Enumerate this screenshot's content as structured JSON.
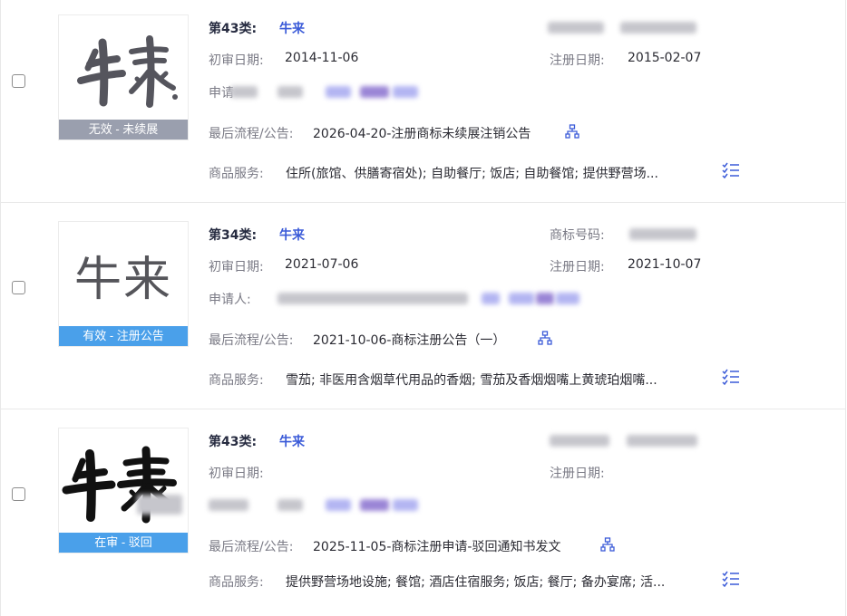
{
  "labels": {
    "first_review": "初审日期:",
    "register_date": "注册日期:",
    "applicant": "申请人:",
    "applicant_partial": "申请",
    "trademark_no": "商标号码:",
    "process": "最后流程/公告:",
    "goods": "商品服务:"
  },
  "records": [
    {
      "class": "第43类:",
      "name": "牛来",
      "first_review_date": "2014-11-06",
      "register_date": "2015-02-07",
      "status": "无效 - 未续展",
      "process": "2026-04-20-注册商标未续展注销公告",
      "goods": "住所(旅馆、供膳寄宿处); 自助餐厅; 饭店; 自助餐馆; 提供野营场..."
    },
    {
      "class": "第34类:",
      "name": "牛来",
      "first_review_date": "2021-07-06",
      "register_date": "2021-10-07",
      "status": "有效 - 注册公告",
      "process": "2021-10-06-商标注册公告（一）",
      "goods": "雪茄; 非医用含烟草代用品的香烟; 雪茄及香烟烟嘴上黄琥珀烟嘴...",
      "thumb_text": "牛来"
    },
    {
      "class": "第43类:",
      "name": "牛来",
      "first_review_date": "",
      "register_date": "",
      "status": "在审 - 驳回",
      "process": "2025-11-05-商标注册申请-驳回通知书发文",
      "goods": "提供野营场地设施; 餐馆; 酒店住宿服务; 饭店; 餐厅; 备办宴席; 活..."
    }
  ],
  "colors": {
    "accent": "#3b5bd8",
    "status_gray": "#9a9fae",
    "status_blue": "#4aa0ea"
  },
  "icons": [
    "checkbox",
    "org-chart-icon",
    "list-icon"
  ]
}
